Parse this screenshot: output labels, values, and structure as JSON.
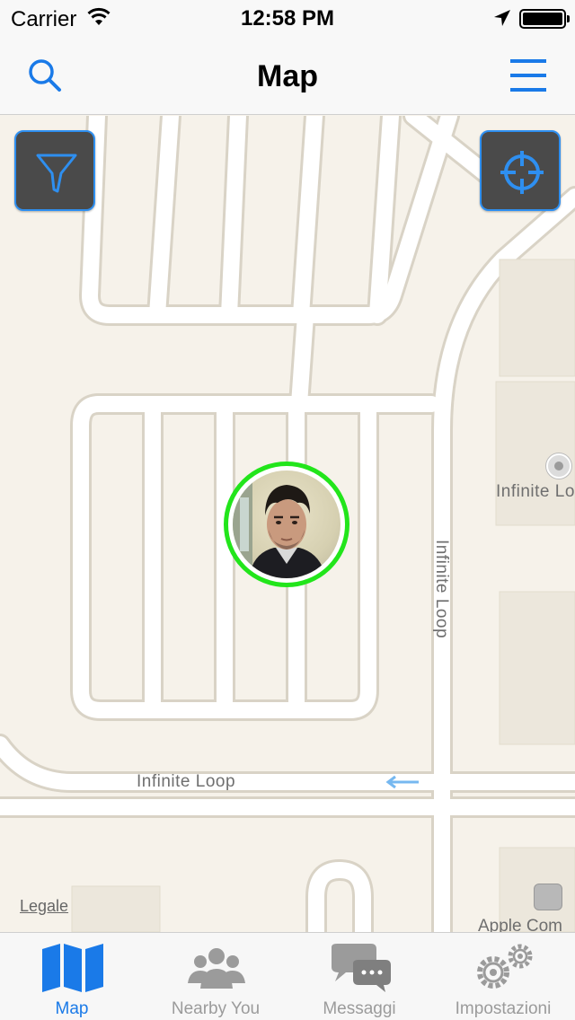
{
  "status_bar": {
    "carrier": "Carrier",
    "time": "12:58 PM"
  },
  "nav": {
    "title": "Map",
    "left_icon": "search-icon",
    "right_icon": "menu-icon"
  },
  "map": {
    "buttons": {
      "filter_icon": "filter-icon",
      "locate_icon": "crosshair-icon"
    },
    "labels": {
      "street_horizontal": "Infinite Loop",
      "street_vertical": "Infinite Loop",
      "poi_infinite": "Infinite Lo",
      "poi_apple": "Apple Com",
      "legal": "Legale"
    },
    "user_marker": {
      "ring_color": "#22e51b",
      "icon": "user-avatar"
    }
  },
  "tabs": [
    {
      "label": "Map",
      "icon": "map-icon",
      "active": true
    },
    {
      "label": "Nearby You",
      "icon": "people-icon",
      "active": false
    },
    {
      "label": "Messaggi",
      "icon": "chat-bubbles-icon",
      "active": false
    },
    {
      "label": "Impostazioni",
      "icon": "gears-icon",
      "active": false
    }
  ],
  "colors": {
    "accent": "#1a7ae8",
    "map_background": "#f6f2ea",
    "road": "#ffffff",
    "road_border": "#d9d3c6",
    "inactive_tab": "#9b9b9b"
  }
}
